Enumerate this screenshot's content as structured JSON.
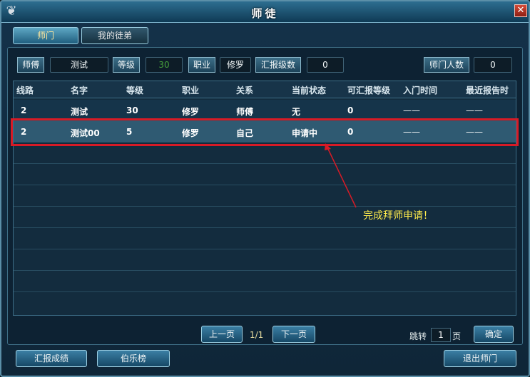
{
  "window": {
    "title": "师徒",
    "close_glyph": "✕"
  },
  "tabs": [
    {
      "label": "师门"
    },
    {
      "label": "我的徒弟"
    }
  ],
  "infobar": {
    "master_label": "师傅",
    "master_value": "测试",
    "level_label": "等级",
    "level_value": "30",
    "job_label": "职业",
    "job_value": "修罗",
    "report_label": "汇报级数",
    "report_value": "0",
    "members_label": "师门人数",
    "members_value": "0"
  },
  "table": {
    "headers": [
      "线路",
      "名字",
      "等级",
      "职业",
      "关系",
      "当前状态",
      "可汇报等级",
      "入门时间",
      "最近报告时"
    ],
    "rows": [
      [
        "2",
        "测试",
        "30",
        "修罗",
        "师傅",
        "无",
        "0",
        "——",
        "——"
      ],
      [
        "2",
        "测试00",
        "5",
        "修罗",
        "自己",
        "申请中",
        "0",
        "——",
        "——"
      ]
    ]
  },
  "annotation": {
    "text": "完成拜师申请！",
    "color": "#ffec4c",
    "highlight_color": "#d71b26"
  },
  "pagination": {
    "prev_label": "上一页",
    "page_info": "1/1",
    "next_label": "下一页",
    "jump_label": "跳转",
    "page_input": "1",
    "page_suffix": "页",
    "confirm_label": "确定"
  },
  "footer": {
    "report_button": "汇报成绩",
    "ranking_button": "伯乐榜",
    "quit_button": "退出师门"
  }
}
